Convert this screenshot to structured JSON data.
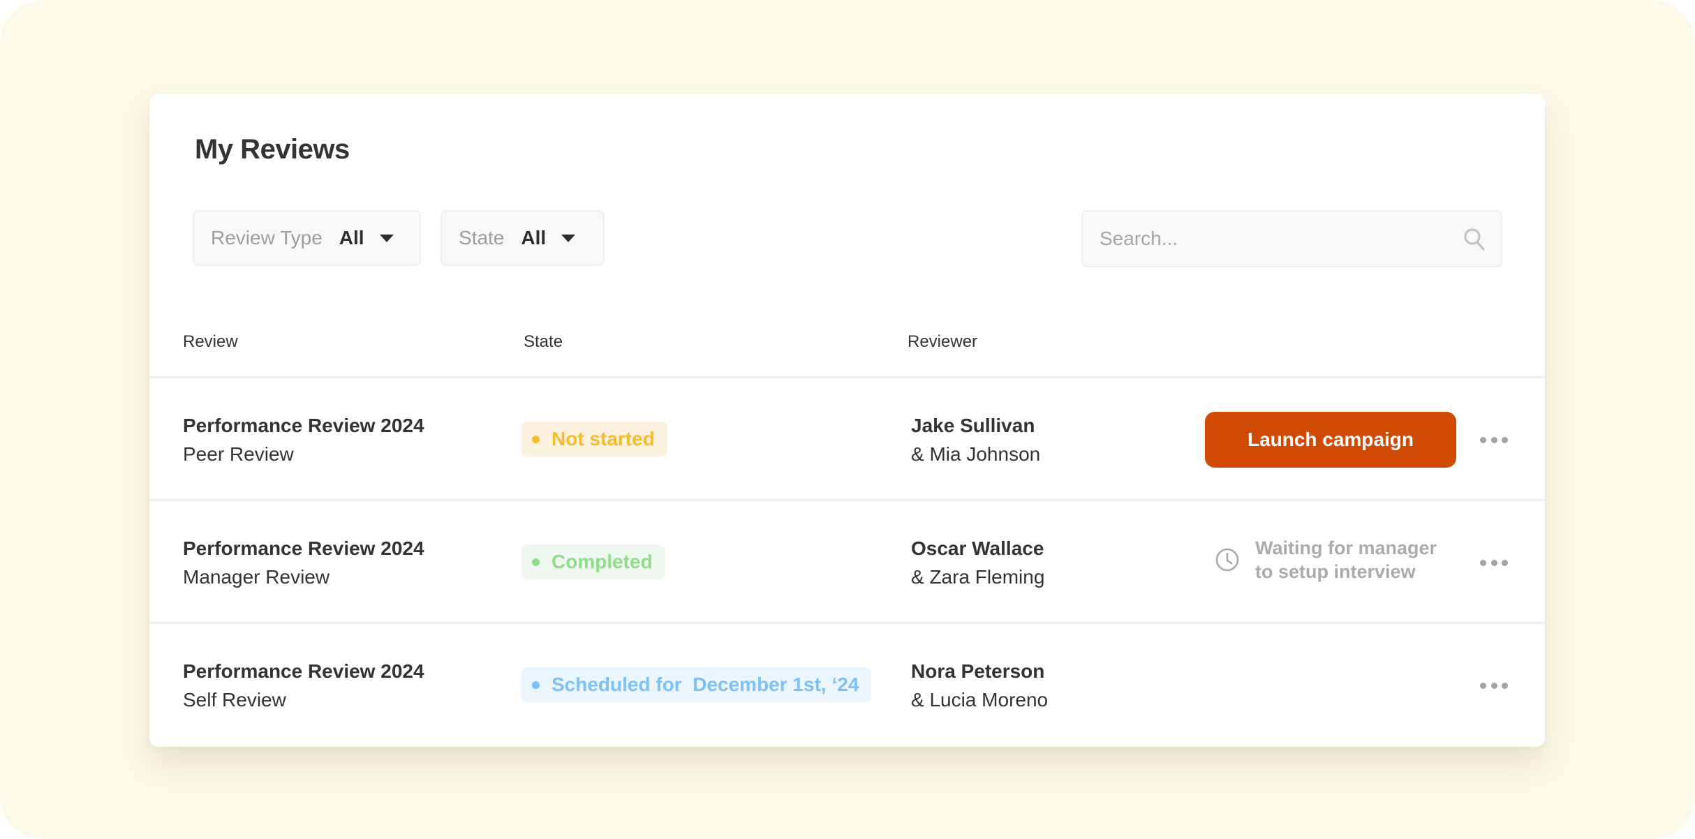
{
  "page": {
    "title": "My Reviews"
  },
  "filters": [
    {
      "label": "Review Type",
      "value": "All"
    },
    {
      "label": "State",
      "value": "All"
    }
  ],
  "search": {
    "placeholder": "Search...",
    "value": ""
  },
  "table": {
    "headers": [
      "Review",
      "State",
      "Reviewer"
    ],
    "rows": [
      {
        "review_title": "Performance Review 2024",
        "review_type": "Peer Review",
        "state": "Not started",
        "state_style": {
          "text": "#f5bd2a",
          "bg": "#fbf1de"
        },
        "reviewer": "Jake Sullivan",
        "co_reviewer": "& Mia Johnson",
        "action": {
          "kind": "button",
          "label": "Launch campaign",
          "color": "#d04a04"
        }
      },
      {
        "review_title": "Performance Review 2024",
        "review_type": "Manager Review",
        "state": "Completed",
        "state_style": {
          "text": "#8fdc8b",
          "bg": "#eff9ef"
        },
        "reviewer": "Oscar Wallace",
        "co_reviewer": "& Zara Fleming",
        "action": {
          "kind": "status",
          "icon": "clock-icon",
          "label": "Waiting for manager to setup interview"
        }
      },
      {
        "review_title": "Performance Review 2024",
        "review_type": "Self Review",
        "state": "Scheduled for  December 1st, ‘24",
        "state_style": {
          "text": "#7cc1f7",
          "bg": "#eaf5fe"
        },
        "reviewer": "Nora Peterson",
        "co_reviewer": "& Lucia Moreno",
        "action": null
      }
    ]
  }
}
